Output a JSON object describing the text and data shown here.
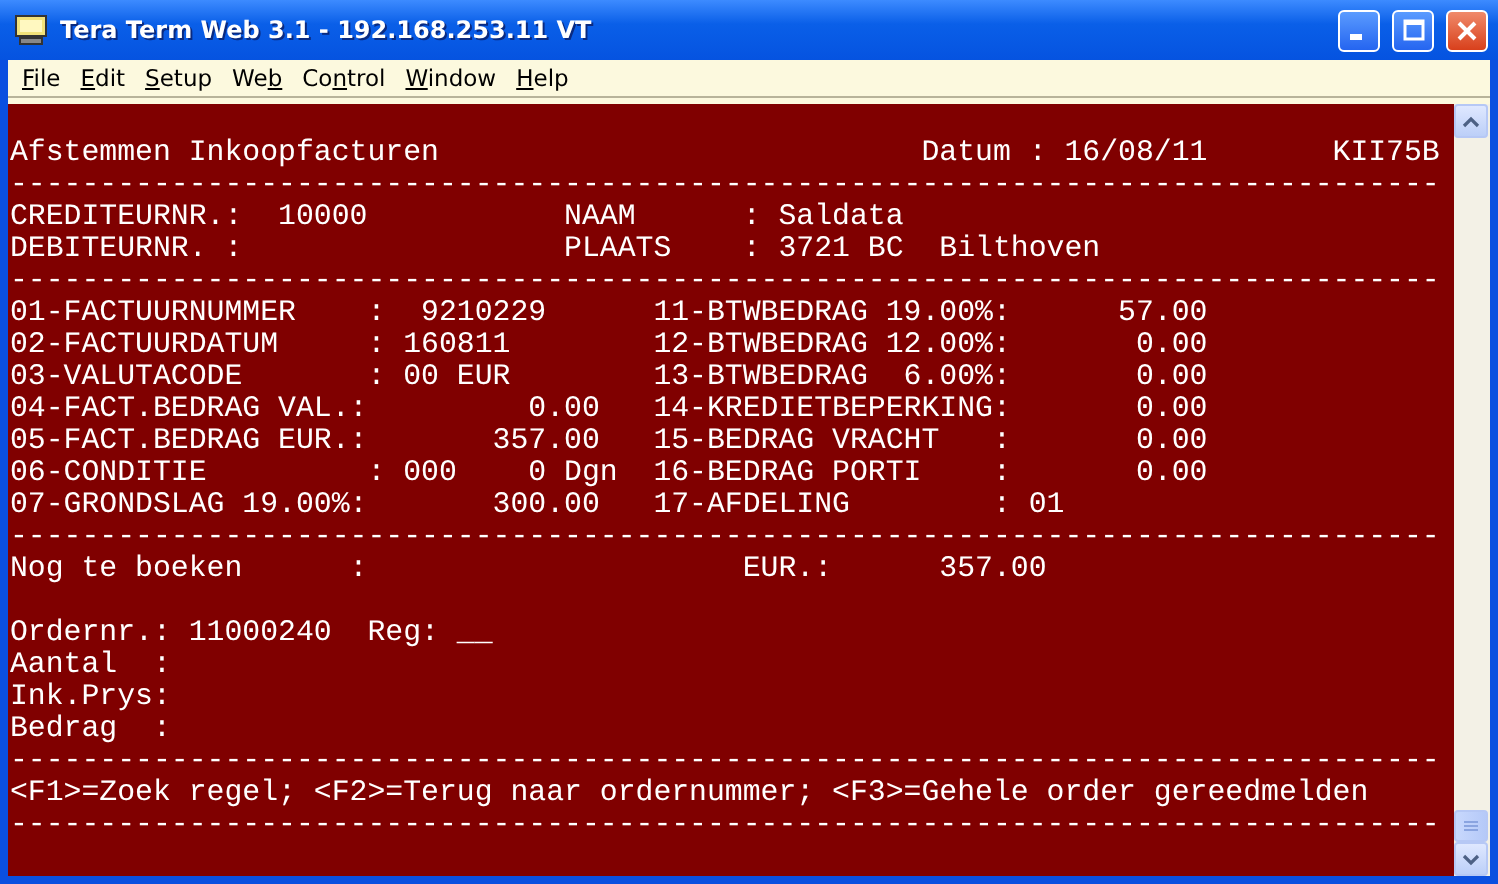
{
  "window": {
    "title": "Tera Term Web 3.1 - 192.168.253.11 VT"
  },
  "menu": [
    {
      "label": [
        {
          "t": "F",
          "u": true
        },
        {
          "t": "ile",
          "u": false
        }
      ]
    },
    {
      "label": [
        {
          "t": "E",
          "u": true
        },
        {
          "t": "dit",
          "u": false
        }
      ]
    },
    {
      "label": [
        {
          "t": "S",
          "u": true
        },
        {
          "t": "etup",
          "u": false
        }
      ]
    },
    {
      "label": [
        {
          "t": "We",
          "u": false
        },
        {
          "t": "b",
          "u": true
        }
      ]
    },
    {
      "label": [
        {
          "t": "Co",
          "u": false
        },
        {
          "t": "n",
          "u": true
        },
        {
          "t": "trol",
          "u": false
        }
      ]
    },
    {
      "label": [
        {
          "t": "W",
          "u": true
        },
        {
          "t": "indow",
          "u": false
        }
      ]
    },
    {
      "label": [
        {
          "t": "H",
          "u": true
        },
        {
          "t": "elp",
          "u": false
        }
      ]
    }
  ],
  "terminal": {
    "lines": [
      {
        "text": "Afstemmen Inkoopfacturen                           Datum : 16/08/11       KII75B"
      },
      {
        "text": "--------------------------------------------------------------------------------"
      },
      {
        "text": "CREDITEURNR.:  10000           NAAM      : Saldata"
      },
      {
        "text": "DEBITEURNR. :                  PLAATS    : 3721 BC  Bilthoven"
      },
      {
        "text": "--------------------------------------------------------------------------------"
      },
      {
        "text": "01-FACTUURNUMMER    :  9210229      11-BTWBEDRAG 19.00%:      57.00"
      },
      {
        "text": "02-FACTUURDATUM     : 160811        12-BTWBEDRAG 12.00%:       0.00"
      },
      {
        "text": "03-VALUTACODE       : 00 EUR        13-BTWBEDRAG  6.00%:       0.00"
      },
      {
        "text": "04-FACT.BEDRAG VAL.:         0.00   14-KREDIETBEPERKING:       0.00"
      },
      {
        "text": "05-FACT.BEDRAG EUR.:       357.00   15-BEDRAG VRACHT   :       0.00"
      },
      {
        "text": "06-CONDITIE         : 000    0 Dgn  16-BEDRAG PORTI    :       0.00"
      },
      {
        "text": "07-GRONDSLAG 19.00%:       300.00   17-AFDELING        : 01"
      },
      {
        "text": "--------------------------------------------------------------------------------"
      },
      {
        "text": "Nog te boeken      :                     EUR.:      357.00"
      },
      {
        "blank_before": true,
        "text": "Ordernr.: 11000240  Reg: __"
      },
      {
        "text": "Aantal  :"
      },
      {
        "text": "Ink.Prys:"
      },
      {
        "text": "Bedrag  :"
      },
      {
        "text": "--------------------------------------------------------------------------------"
      },
      {
        "text": "<F1>=Zoek regel; <F2>=Terug naar ordernummer; <F3>=Gehele order gereedmelden"
      },
      {
        "text": "--------------------------------------------------------------------------------"
      }
    ]
  }
}
